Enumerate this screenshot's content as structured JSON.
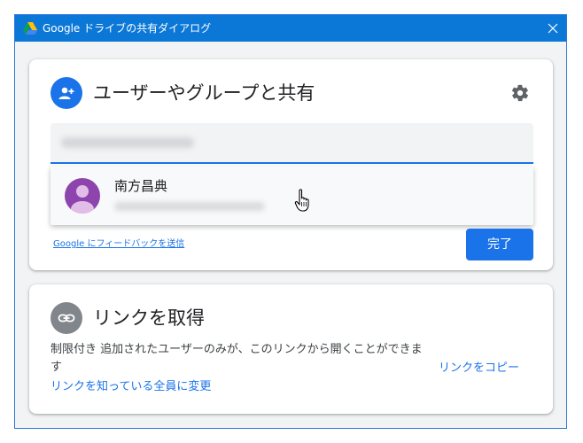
{
  "window": {
    "title": "Google ドライブの共有ダイアログ",
    "close_symbol": "✕"
  },
  "share_section": {
    "title": "ユーザーやグループと共有",
    "icon": "add-person-icon",
    "settings_icon": "gear-icon",
    "input": {
      "value": "",
      "note": "obscured"
    },
    "suggestion": {
      "name": "南方昌典",
      "avatar_icon": "person-avatar-icon",
      "avatar_color": "#8e44ad"
    },
    "feedback_link": "Google にフィードバックを送信",
    "done_button": "完了"
  },
  "link_section": {
    "title": "リンクを取得",
    "icon": "link-icon",
    "description": "制限付き 追加されたユーザーのみが、このリンクから開くことができます",
    "change_link": "リンクを知っている全員に変更",
    "copy_link": "リンクをコピー"
  },
  "colors": {
    "titlebar": "#0b78d7",
    "accent": "#1a73e8",
    "link_icon_bg": "#80868b",
    "background": "#f1f3f4"
  }
}
